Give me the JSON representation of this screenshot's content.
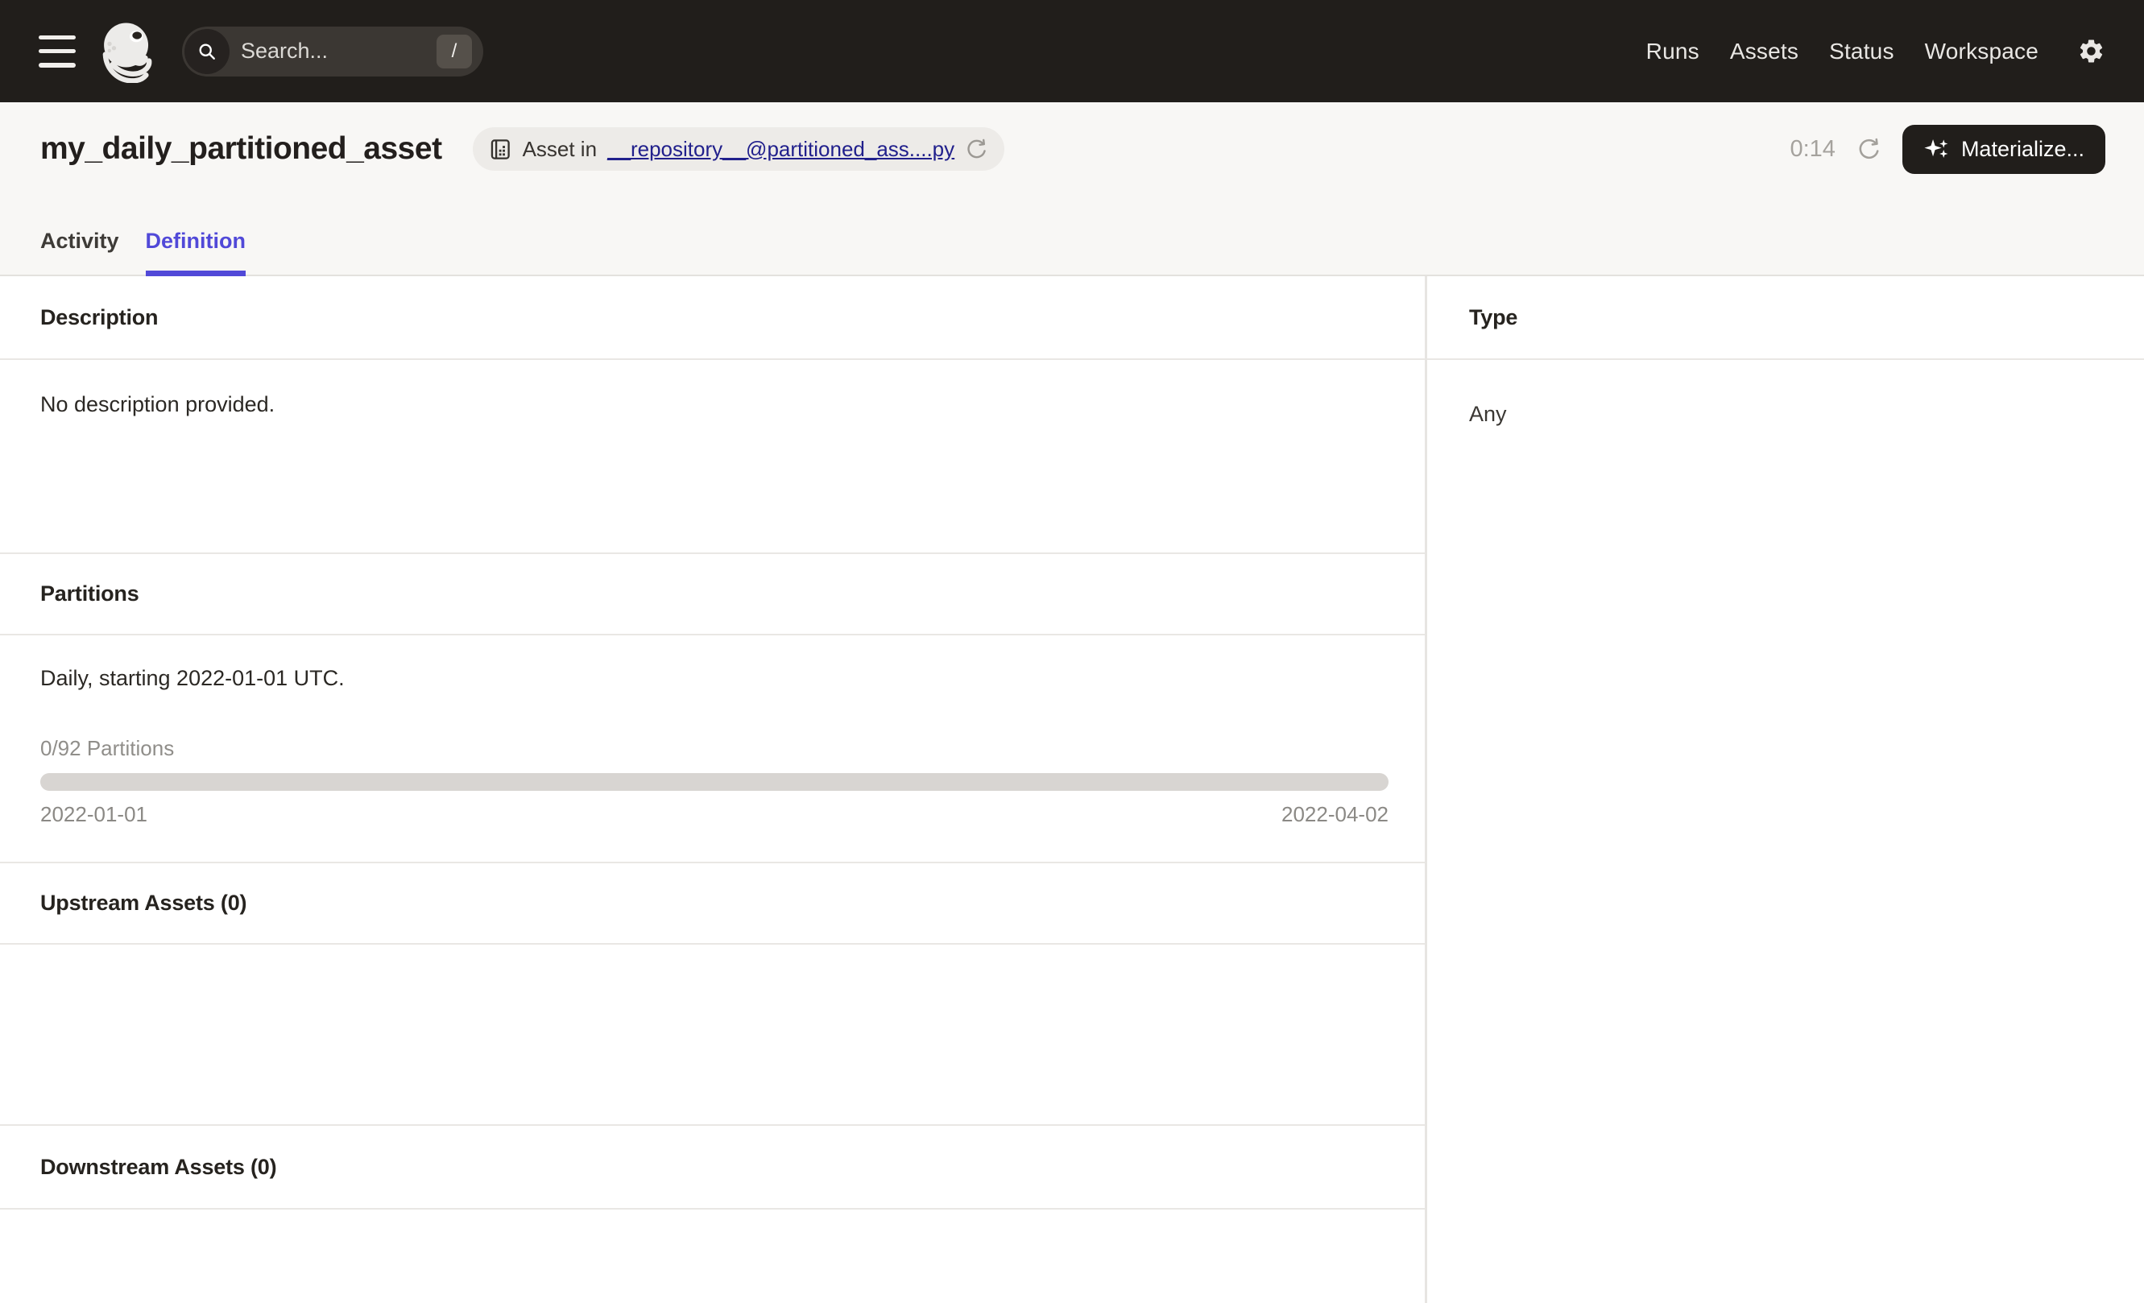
{
  "nav": {
    "search": {
      "placeholder": "Search...",
      "shortcut_key": "/"
    },
    "items": [
      {
        "label": "Runs"
      },
      {
        "label": "Assets"
      },
      {
        "label": "Status"
      },
      {
        "label": "Workspace"
      }
    ]
  },
  "header": {
    "title": "my_daily_partitioned_asset",
    "origin_badge": {
      "prefix": "Asset in",
      "link_text": "__repository__@partitioned_ass....py"
    },
    "auto_refresh_timer": "0:14",
    "materialize_button": {
      "label": "Materialize..."
    }
  },
  "tabs": [
    {
      "label": "Activity",
      "active": false
    },
    {
      "label": "Definition",
      "active": true
    }
  ],
  "main": {
    "description": {
      "heading": "Description",
      "body": "No description provided."
    },
    "partitions": {
      "heading": "Partitions",
      "summary": "Daily, starting 2022-01-01 UTC.",
      "count_label": "0/92 Partitions",
      "progress_percent": 0,
      "range_start": "2022-01-01",
      "range_end": "2022-04-02"
    },
    "upstream": {
      "heading": "Upstream Assets (0)"
    },
    "downstream": {
      "heading": "Downstream Assets (0)"
    },
    "type_panel": {
      "heading": "Type",
      "value": "Any"
    }
  },
  "icons": {
    "menu": "hamburger-icon",
    "logo": "dagster-logo",
    "search": "magnifier-icon",
    "shortcut": "slash-keycap",
    "settings": "gear-icon",
    "badge_asset": "repo-grid-icon",
    "badge_reload": "reload-icon",
    "header_refresh": "refresh-icon",
    "materialize": "sparkles-icon"
  },
  "colors": {
    "nav_bg": "#211E1B",
    "nav_text": "#E9E7E4",
    "header_bg": "#F8F7F5",
    "badge_bg": "#EDEBE8",
    "accent": "#5149D8",
    "link": "#21208C",
    "text": "#231F1D",
    "muted": "#908E8A",
    "progress_track": "#D8D5D2",
    "button_bg": "#211E1B"
  }
}
